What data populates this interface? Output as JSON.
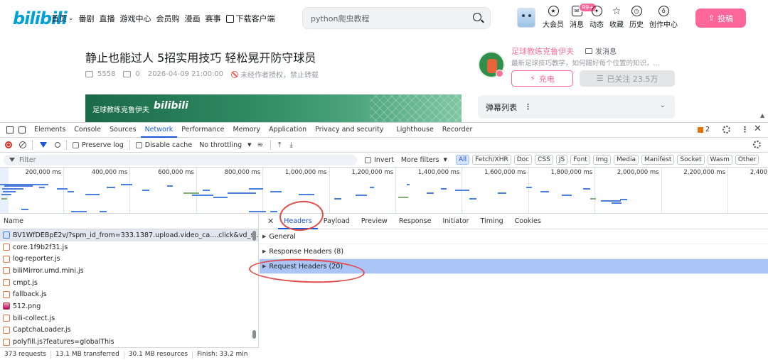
{
  "header": {
    "logo": "bilibili",
    "nav": [
      {
        "label": "首页",
        "chevron": true
      },
      {
        "label": "番剧"
      },
      {
        "label": "直播"
      },
      {
        "label": "游戏中心"
      },
      {
        "label": "会员购"
      },
      {
        "label": "漫画"
      },
      {
        "label": "赛事"
      }
    ],
    "download_label": "下载客户端",
    "search_value": "python爬虫教程",
    "menu": [
      {
        "label": "大会员",
        "icon": "vip-icon"
      },
      {
        "label": "消息",
        "icon": "message-icon",
        "badge": "99+"
      },
      {
        "label": "动态",
        "icon": "dynamic-icon"
      },
      {
        "label": "收藏",
        "icon": "star-icon"
      },
      {
        "label": "历史",
        "icon": "history-icon"
      },
      {
        "label": "创作中心",
        "icon": "bulb-icon"
      }
    ],
    "upload_label": "投稿",
    "accent": "#ff6699"
  },
  "video": {
    "title": "静止也能过人 5招实用技巧 轻松晃开防守球员",
    "views": "5558",
    "danmaku_count": "0",
    "date": "2026-04-09 21:00:00",
    "copyright": "未经作者授权，禁止转载",
    "banner_text": "足球教练克鲁伊夫",
    "banner_logo": "bilibili"
  },
  "uploader": {
    "name": "足球教练克鲁伊夫",
    "message_label": "发消息",
    "desc": "最新足球技巧教学，如何踢好每个位置的知识，...",
    "charge_label": "充电",
    "follow_label": "已关注 23.5万"
  },
  "danmaku_list": {
    "label": "弹幕列表"
  },
  "devtools": {
    "tabs": [
      "Elements",
      "Console",
      "Sources",
      "Network",
      "Performance",
      "Memory",
      "Application",
      "Privacy and security",
      "Lighthouse",
      "Recorder"
    ],
    "active_tab": "Network",
    "issues_count": "2",
    "toolbar": {
      "preserve_log": "Preserve log",
      "disable_cache": "Disable cache",
      "throttling": "No throttling"
    },
    "filter": {
      "placeholder": "Filter",
      "invert": "Invert",
      "more_filters": "More filters",
      "types": [
        "All",
        "Fetch/XHR",
        "Doc",
        "CSS",
        "JS",
        "Font",
        "Img",
        "Media",
        "Manifest",
        "Socket",
        "Wasm",
        "Other"
      ]
    },
    "timeline_ticks": [
      "200,000 ms",
      "400,000 ms",
      "600,000 ms",
      "800,000 ms",
      "1,000,000 ms",
      "1,200,000 ms",
      "1,400,000 ms",
      "1,600,000 ms",
      "1,800,000 ms",
      "2,000,000 ms",
      "2,200,000 ms",
      "2,400,000 ms"
    ],
    "requests_header": "Name",
    "requests": [
      {
        "name": "BV1WfDEBpE2v/?spm_id_from=333.1387.upload.video_ca....click&vd_s...",
        "type": "doc"
      },
      {
        "name": "core.1f9b2f31.js",
        "type": "js"
      },
      {
        "name": "log-reporter.js",
        "type": "js"
      },
      {
        "name": "biliMirror.umd.mini.js",
        "type": "js"
      },
      {
        "name": "cmpt.js",
        "type": "js"
      },
      {
        "name": "fallback.js",
        "type": "js"
      },
      {
        "name": "512.png",
        "type": "img"
      },
      {
        "name": "bili-collect.js",
        "type": "js"
      },
      {
        "name": "CaptchaLoader.js",
        "type": "js"
      },
      {
        "name": "polyfill.js?features=globalThis",
        "type": "js"
      }
    ],
    "status": {
      "requests": "373 requests",
      "transferred": "13.1 MB transferred",
      "resources": "30.1 MB resources",
      "finish": "Finish: 33.2 min"
    },
    "detail_tabs": [
      "Headers",
      "Payload",
      "Preview",
      "Response",
      "Initiator",
      "Timing",
      "Cookies"
    ],
    "detail_active": "Headers",
    "sections": [
      {
        "label": "General",
        "highlight": false
      },
      {
        "label": "Response Headers (8)",
        "highlight": false
      },
      {
        "label": "Request Headers (20)",
        "highlight": true
      }
    ],
    "accent": "#1a56d6"
  }
}
